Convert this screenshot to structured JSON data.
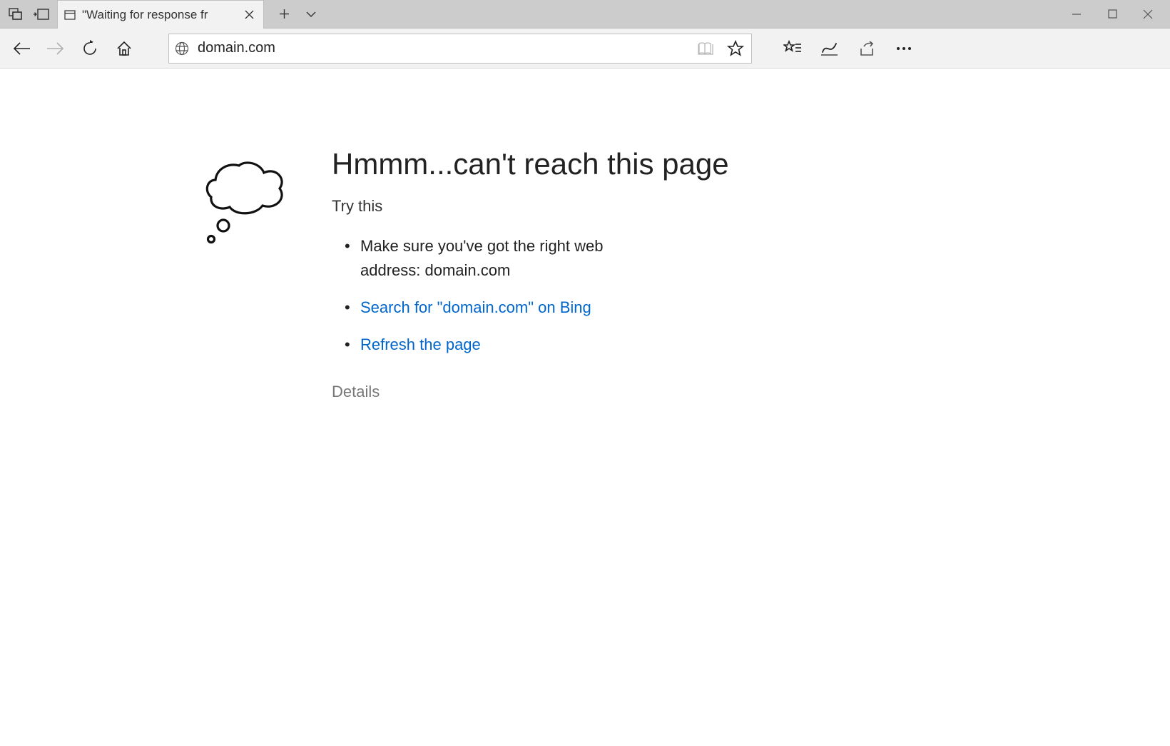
{
  "tab": {
    "title": "\"Waiting for response fr"
  },
  "address": {
    "value": "domain.com"
  },
  "error": {
    "title": "Hmmm...can't reach this page",
    "try_label": "Try this",
    "item_check_address": "Make sure you've got the right web address: domain.com",
    "item_search_bing": "Search for \"domain.com\" on Bing",
    "item_refresh": "Refresh the page",
    "details_label": "Details"
  }
}
